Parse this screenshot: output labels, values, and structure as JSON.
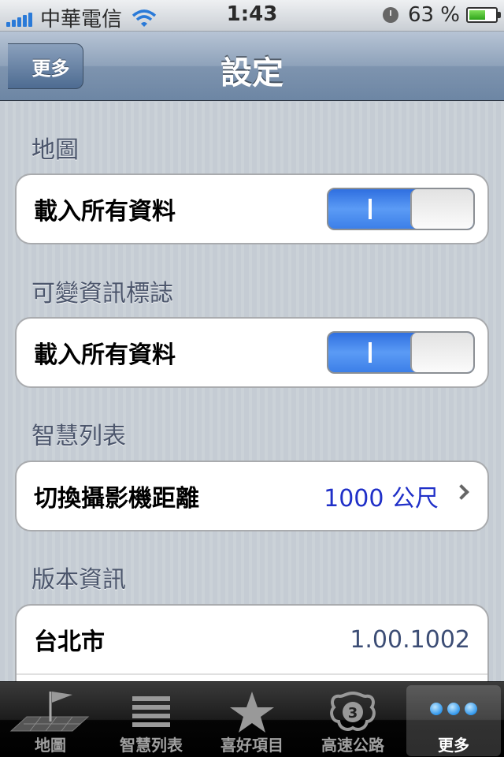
{
  "status_bar": {
    "carrier": "中華電信",
    "time": "1:43",
    "battery": "63 %",
    "battery_level": 0.63,
    "icons": [
      "signal-icon",
      "wifi-icon",
      "clock-icon",
      "battery-icon"
    ]
  },
  "navbar": {
    "back_label": "更多",
    "title": "設定"
  },
  "sections": [
    {
      "header": "地圖",
      "row_label": "載入所有資料",
      "switch_on": true
    },
    {
      "header": "可變資訊標誌",
      "row_label": "載入所有資料",
      "switch_on": true
    },
    {
      "header": "智慧列表",
      "row_label": "切換攝影機距離",
      "row_value": "1000 公尺"
    },
    {
      "header": "版本資訊",
      "row_label": "台北市",
      "row_value": "1.00.1002"
    }
  ],
  "tabs": [
    {
      "label": "地圖",
      "icon": "map-flag-icon"
    },
    {
      "label": "智慧列表",
      "icon": "list-icon"
    },
    {
      "label": "喜好項目",
      "icon": "star-icon"
    },
    {
      "label": "高速公路",
      "icon": "highway-shield-icon"
    },
    {
      "label": "更多",
      "icon": "more-dots-icon",
      "active": true
    }
  ],
  "colors": {
    "switch_on": "#3c7fe8",
    "link_value": "#2030c8",
    "detail_value": "#3c4d75",
    "section_header": "#4c566c"
  }
}
